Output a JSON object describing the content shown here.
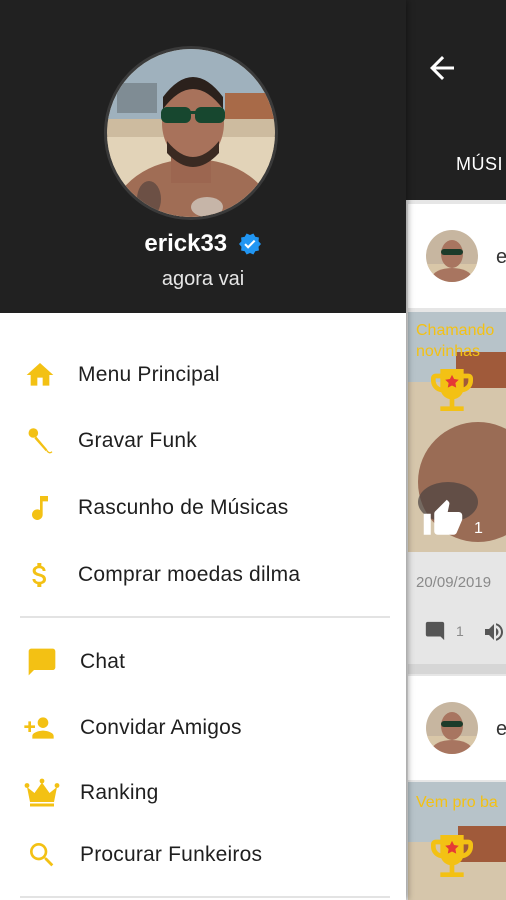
{
  "profile": {
    "username": "erick33",
    "status": "agora vai"
  },
  "menu": {
    "items": [
      {
        "label": "Menu Principal",
        "icon": "home-icon"
      },
      {
        "label": "Gravar Funk",
        "icon": "microphone-icon"
      },
      {
        "label": "Rascunho de Músicas",
        "icon": "music-note-icon"
      },
      {
        "label": "Comprar moedas dilma",
        "icon": "dollar-icon"
      },
      {
        "label": "Chat",
        "icon": "chat-icon"
      },
      {
        "label": "Convidar Amigos",
        "icon": "add-person-icon"
      },
      {
        "label": "Ranking",
        "icon": "crown-icon"
      },
      {
        "label": "Procurar Funkeiros",
        "icon": "search-icon"
      }
    ]
  },
  "background_screen": {
    "tab_label": "MÚSI",
    "posts": [
      {
        "user_initial": "e",
        "title_lines": [
          "Chamando",
          "novinhas"
        ],
        "likes": "1",
        "date": "20/09/2019",
        "comments": "1"
      },
      {
        "user_initial": "e",
        "title_lines": [
          "Vem pro ba"
        ]
      }
    ]
  },
  "colors": {
    "accent": "#F3C114",
    "header_bg": "#212121",
    "verified": "#2196F3",
    "text": "#1F1F1F"
  }
}
